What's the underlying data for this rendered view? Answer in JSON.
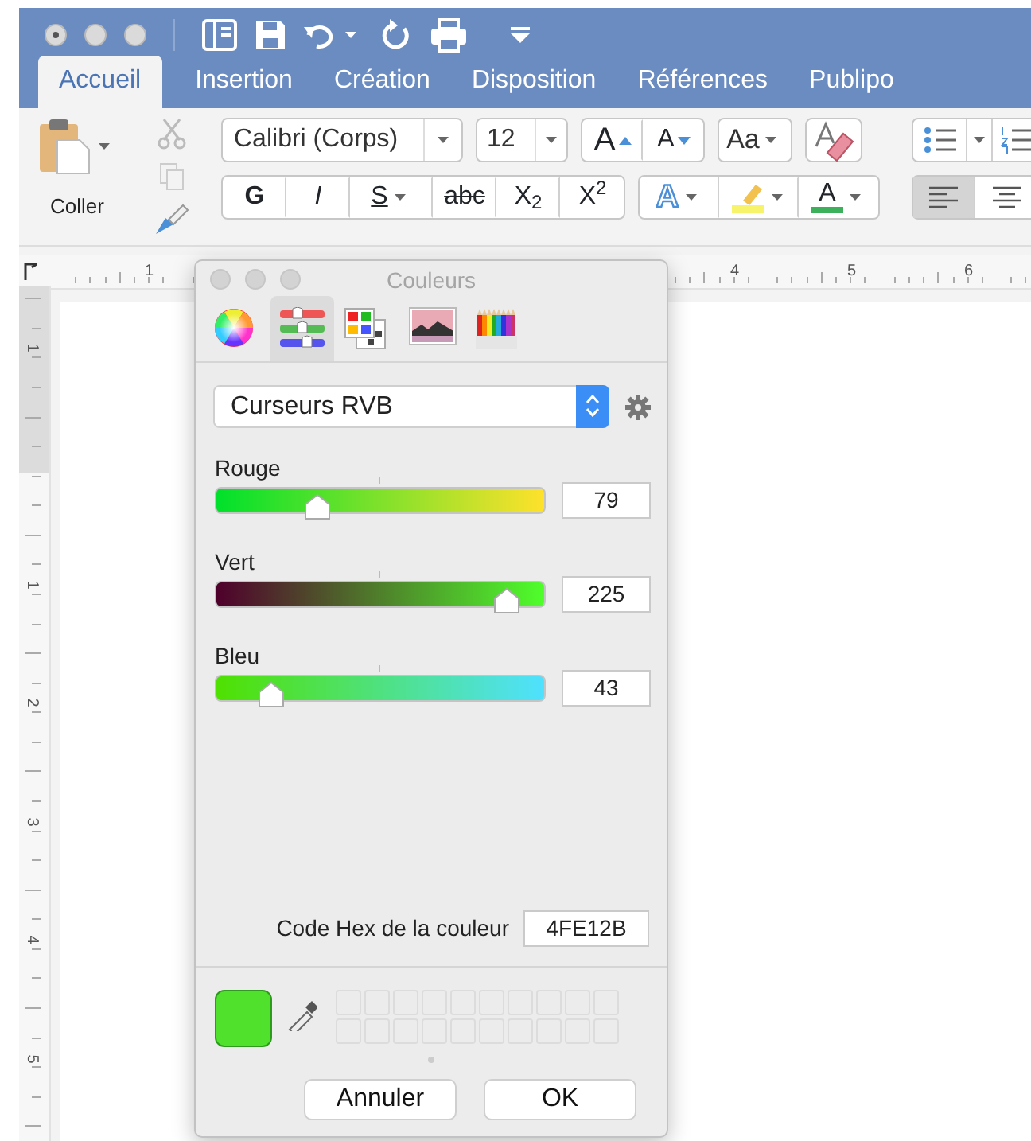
{
  "tabs": [
    {
      "label": "Accueil",
      "selected": true
    },
    {
      "label": "Insertion",
      "selected": false
    },
    {
      "label": "Création",
      "selected": false
    },
    {
      "label": "Disposition",
      "selected": false
    },
    {
      "label": "Références",
      "selected": false
    },
    {
      "label": "Publipo",
      "selected": false
    }
  ],
  "ribbon": {
    "paste_label": "Coller",
    "font_name": "Calibri (Corps)",
    "font_size": "12",
    "size_buttons": [
      {
        "kind": "grow",
        "label": "A"
      },
      {
        "kind": "shrink",
        "label": "A"
      }
    ],
    "case_button": "Aa",
    "format_buttons": [
      {
        "kind": "bold",
        "label": "G"
      },
      {
        "kind": "italic",
        "label": "I"
      },
      {
        "kind": "underline",
        "label": "S"
      },
      {
        "kind": "strike",
        "label": "abc"
      },
      {
        "kind": "sub",
        "label": "X$_{2}$"
      },
      {
        "kind": "sup",
        "label": "X$^{2}$"
      }
    ],
    "effect_buttons": [
      {
        "kind": "effects",
        "label": "A"
      },
      {
        "kind": "highlight"
      },
      {
        "kind": "font-color",
        "label": "A"
      }
    ],
    "alignment": [
      {
        "selected": true
      },
      {
        "selected": false
      }
    ]
  },
  "horizontal_ruler": [
    "1",
    "4",
    "5",
    "6"
  ],
  "vertical_ruler": [
    "1",
    "1",
    "2",
    "3",
    "4",
    "5"
  ],
  "dialog": {
    "title": "Couleurs",
    "modes": [
      {
        "kind": "wheel",
        "selected": false
      },
      {
        "kind": "sliders",
        "selected": true
      },
      {
        "kind": "palettes",
        "selected": false
      },
      {
        "kind": "image",
        "selected": false
      },
      {
        "kind": "pencils",
        "selected": false
      }
    ],
    "mode_select": "Curseurs RVB",
    "sliders": [
      {
        "label": "Rouge",
        "level": 0.31,
        "value": "79"
      },
      {
        "label": "Vert",
        "level": 0.88,
        "value": "225"
      },
      {
        "label": "Bleu",
        "level": 0.17,
        "value": "43"
      }
    ],
    "hex_label": "Code Hex de la couleur",
    "hex": "4FE12B",
    "buttons": [
      "Annuler",
      "OK"
    ]
  }
}
